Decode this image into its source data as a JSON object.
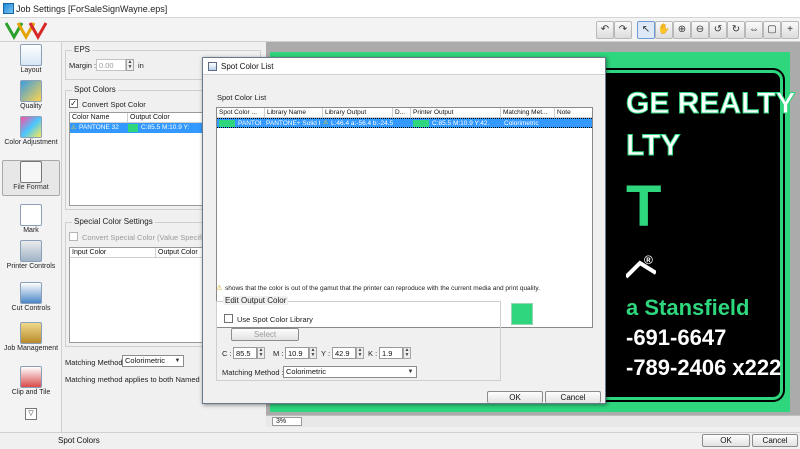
{
  "window": {
    "title": "Job Settings [ForSaleSignWayne.eps]"
  },
  "colors": {
    "accent_green": "#2ed67d",
    "selection_blue": "#3399ff",
    "sign_black": "#000000"
  },
  "toolbar": {
    "buttons": [
      "undo-icon",
      "redo-icon",
      "undo-gray-icon",
      "redo-gray-icon",
      "pointer-icon",
      "hand-icon",
      "zoom-in-icon",
      "zoom-out-icon",
      "rotate-left-icon",
      "rotate-right-icon",
      "fit-width-icon",
      "fit-page-icon",
      "zoom-plus-icon",
      "zoom-minus-icon"
    ]
  },
  "sidebar": {
    "items": [
      {
        "label": "Layout",
        "icon": "layout-icon"
      },
      {
        "label": "Quality",
        "icon": "quality-icon"
      },
      {
        "label": "Color Adjustment",
        "icon": "color-adjustment-icon"
      },
      {
        "label": "File Format",
        "icon": "file-format-icon"
      },
      {
        "label": "Mark",
        "icon": "mark-icon"
      },
      {
        "label": "Printer Controls",
        "icon": "printer-controls-icon"
      },
      {
        "label": "Cut Controls",
        "icon": "cut-controls-icon"
      },
      {
        "label": "Job Management",
        "icon": "job-management-icon"
      },
      {
        "label": "Clip and Tile",
        "icon": "clip-tile-icon"
      }
    ]
  },
  "settings": {
    "eps": {
      "title": "EPS",
      "margin_label": "Margin :",
      "margin_value": "0.00",
      "margin_unit": "in"
    },
    "spot_colors": {
      "title": "Spot Colors",
      "convert_label": "Convert Spot Color",
      "columns": [
        "Color Name",
        "Output Color"
      ],
      "row": {
        "name": "PANTONE 32",
        "output": "C:85.5   M:10.9   Y:"
      }
    },
    "special": {
      "title": "Special Color Settings",
      "convert_label": "Convert Special Color (Value Specified D",
      "columns": [
        "Input Color",
        "Output Color"
      ]
    },
    "matching": {
      "label": "Matching Method",
      "value": "Colorimetric",
      "note": "Matching method applies to both Named and S"
    }
  },
  "dialog": {
    "title": "Spot Color List",
    "list_label": "Spot Color List",
    "columns": [
      "Spot Color ...",
      "Library Name",
      "Library Output",
      "D...",
      "Printer Output",
      "Matching Met...",
      "Note"
    ],
    "row": {
      "spot": "PANTOI",
      "library": "PANTONE+ Solid I",
      "lib_output": "L:46.4   a:-56.4   b:-24.5",
      "printer_output": "C:85.5   M:10.9   Y:42.",
      "method": "Colorimetric"
    },
    "gamut_note": "shows that the color is out of the gamut that the printer can reproduce with the current media and print quality.",
    "edit": {
      "title": "Edit Output Color",
      "use_library_label": "Use Spot Color Library",
      "select_label": "Select",
      "c_label": "C :",
      "c_value": "85.5",
      "m_label": "M :",
      "m_value": "10.9",
      "y_label": "Y :",
      "y_value": "42.9",
      "k_label": "K :",
      "k_value": "1.9",
      "method_label": "Matching Method :",
      "method_value": "Colorimetric"
    },
    "ok_label": "OK",
    "cancel_label": "Cancel"
  },
  "preview": {
    "lines": [
      "GE REALTY",
      "LTY",
      "T",
      "®",
      "a Stansfield",
      "-691-6647",
      "-789-2406 x222"
    ],
    "zoom": "3%"
  },
  "footer": {
    "status": "Spot Colors",
    "ok_label": "OK",
    "cancel_label": "Cancel"
  }
}
